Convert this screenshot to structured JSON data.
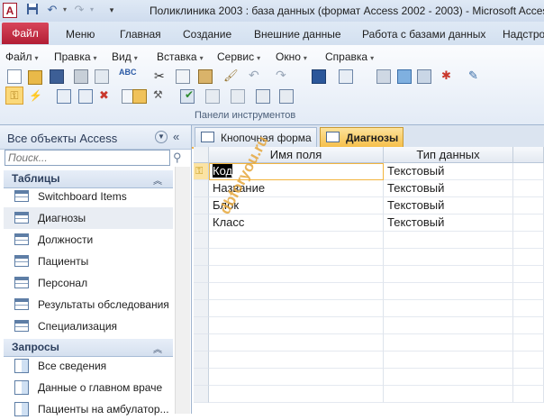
{
  "app": {
    "title": "Поликлиника 2003 : база данных (формат Access 2002 - 2003)  -  Microsoft Access",
    "icon_letter": "A"
  },
  "quick_access": [
    {
      "icon": "save-icon",
      "glyph": "■"
    },
    {
      "icon": "undo-icon",
      "glyph": "↶"
    },
    {
      "icon": "redo-icon",
      "glyph": "↷"
    },
    {
      "icon": "customize-qat-icon",
      "glyph": "▾"
    }
  ],
  "ribbon_tabs": [
    "Файл",
    "Меню",
    "Главная",
    "Создание",
    "Внешние данные",
    "Работа с базами данных",
    "Надстро"
  ],
  "legacy_menu": [
    "Файл",
    "Правка",
    "Вид",
    "Вставка",
    "Сервис",
    "Окно",
    "Справка"
  ],
  "ribbon_group_label": "Панели инструментов",
  "nav_pane": {
    "title": "Все объекты Access",
    "search_placeholder": "Поиск...",
    "tables_header": "Таблицы",
    "tables": [
      "Switchboard Items",
      "Диагнозы",
      "Должности",
      "Пациенты",
      "Персонал",
      "Результаты обследования",
      "Специализация"
    ],
    "selected_table": "Диагнозы",
    "queries_header": "Запросы",
    "queries": [
      "Все сведения",
      "Данные о главном враче",
      "Пациенты на амбулатор..."
    ]
  },
  "doc_tabs": [
    {
      "label": "Кнопочная форма",
      "active": false
    },
    {
      "label": "Диагнозы",
      "active": true
    }
  ],
  "design_grid": {
    "columns": [
      "Имя поля",
      "Тип данных"
    ],
    "rows": [
      {
        "field_name": "Код",
        "data_type": "Текстовый",
        "primary_key": true
      },
      {
        "field_name": "Название",
        "data_type": "Текстовый",
        "primary_key": false
      },
      {
        "field_name": "Блок",
        "data_type": "Текстовый",
        "primary_key": false
      },
      {
        "field_name": "Класс",
        "data_type": "Текстовый",
        "primary_key": false
      }
    ]
  },
  "watermark": "dbforyou.ru",
  "colors": {
    "file_tab": "#b21e35",
    "active_doc_tab": "#f6bf4a",
    "accent_border": "#f3b243"
  }
}
